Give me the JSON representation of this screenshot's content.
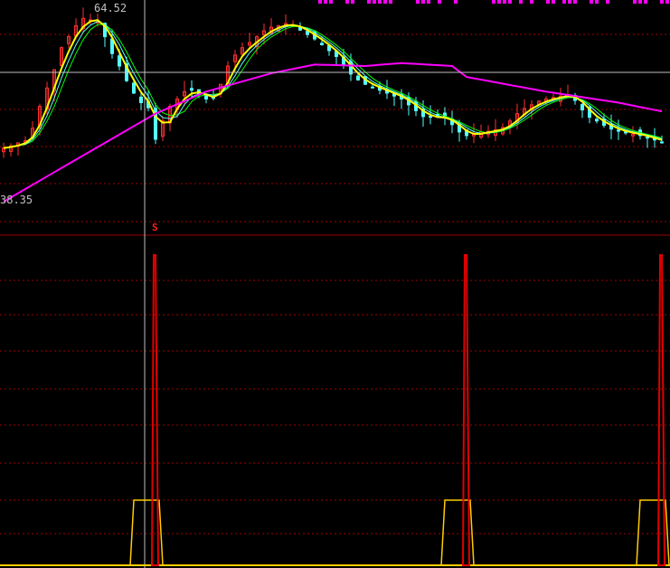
{
  "chart_data": {
    "type": "candlestick",
    "title": "",
    "price_high_label": "64.52",
    "price_low_label": "38.35",
    "ylim": [
      36.0,
      65.5
    ],
    "closes": [
      45.3,
      45.6,
      46.0,
      46.3,
      48.0,
      51.0,
      53.5,
      56.0,
      59.0,
      60.5,
      62.0,
      63.0,
      62.8,
      62.5,
      60.5,
      58.2,
      56.5,
      54.5,
      52.8,
      51.5,
      50.8,
      46.5,
      49.0,
      51.0,
      52.0,
      53.0,
      53.2,
      52.6,
      52.0,
      52.2,
      54.0,
      56.5,
      58.0,
      59.0,
      59.7,
      60.5,
      61.3,
      61.8,
      62.0,
      62.3,
      62.0,
      61.4,
      60.8,
      60.2,
      59.4,
      58.6,
      57.8,
      56.6,
      55.4,
      54.6,
      54.0,
      53.6,
      53.2,
      52.8,
      52.4,
      52.0,
      51.2,
      50.4,
      49.6,
      49.5,
      49.5,
      49.4,
      48.5,
      47.5,
      47.0,
      47.2,
      47.5,
      47.6,
      47.8,
      48.1,
      49.0,
      50.0,
      50.7,
      51.2,
      51.7,
      52.0,
      52.2,
      52.4,
      52.6,
      51.8,
      50.5,
      49.5,
      49.0,
      48.4,
      47.9,
      47.6,
      47.4,
      47.2,
      47.0,
      46.7,
      46.4,
      46.1
    ],
    "ma_long_keypoints": [
      [
        0,
        38.0
      ],
      [
        21,
        50.0
      ],
      [
        28,
        53.0
      ],
      [
        37,
        55.5
      ],
      [
        43,
        56.7
      ],
      [
        50,
        56.5
      ],
      [
        55,
        56.9
      ],
      [
        62,
        56.5
      ],
      [
        64,
        55.0
      ],
      [
        75,
        53.0
      ],
      [
        85,
        51.5
      ],
      [
        91,
        50.3
      ]
    ],
    "signal_label": "S",
    "signal_bar": 20,
    "indicator": {
      "ylim": [
        0,
        100
      ],
      "spike_value": 100,
      "plateau_value": 21,
      "signal_bars": [
        21,
        64,
        91
      ]
    },
    "colors": {
      "up": "#ff3030",
      "down": "#54ffff",
      "ma_short": "#ffff00",
      "ma_mid": "#54ffff",
      "ma_mid2": "#00ff00",
      "ma_long": "#ff00ff",
      "grid": "#a00000",
      "spike": "#e00000",
      "plateau": "#ffcc00"
    }
  }
}
